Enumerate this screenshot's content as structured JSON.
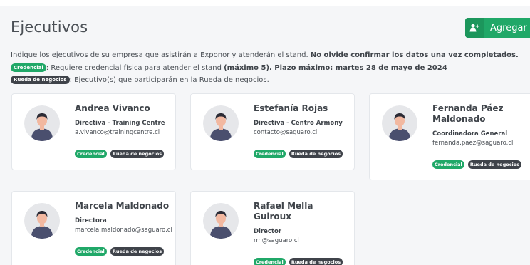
{
  "page": {
    "title": "Ejecutivos",
    "add_button_label": "Agregar"
  },
  "info": {
    "line1_text": "Indique los ejecutivos de su empresa que asistirán a Exponor y atenderán el stand. ",
    "line1_bold": "No olvide confirmar los datos una vez completados.",
    "line2_badge": "Credencial",
    "line2_text": ": Requiere credencial física para atender el stand ",
    "line2_bold": "(máximo 5). Plazo máximo: martes 28 de mayo de 2024",
    "line3_badge": "Rueda de negocios",
    "line3_text": ": Ejecutivo(s) que participarán en la Rueda de negocios."
  },
  "executives": [
    {
      "name": "Andrea Vivanco",
      "role": "Directiva - Training Centre",
      "email": "a.vivanco@trainingcentre.cl",
      "badge_credencial": "Credencial",
      "badge_rueda": "Rueda de negocios"
    },
    {
      "name": "Estefanía Rojas",
      "role": "Directiva - Centro Armony",
      "email": "contacto@saguaro.cl",
      "badge_credencial": "Credencial",
      "badge_rueda": "Rueda de negocios"
    },
    {
      "name": "Fernanda Páez Maldonado",
      "role": "Coordinadora General",
      "email": "fernanda.paez@saguaro.cl",
      "badge_credencial": "Credencial",
      "badge_rueda": "Rueda de negocios"
    },
    {
      "name": "Marcela Maldonado",
      "role": "Directora",
      "email": "marcela.maldonado@saguaro.cl",
      "badge_credencial": "Credencial",
      "badge_rueda": "Rueda de negocios"
    },
    {
      "name": "Rafael Mella Guiroux",
      "role": "Director",
      "email": "rm@saguaro.cl",
      "badge_credencial": "Credencial",
      "badge_rueda": "Rueda de negocios"
    }
  ],
  "colors": {
    "accent_green": "#20a868",
    "badge_dark": "#3f434a",
    "text": "#4a4f55"
  },
  "icons": {
    "add_button": "add-user-icon",
    "avatar": "person-avatar-icon"
  }
}
